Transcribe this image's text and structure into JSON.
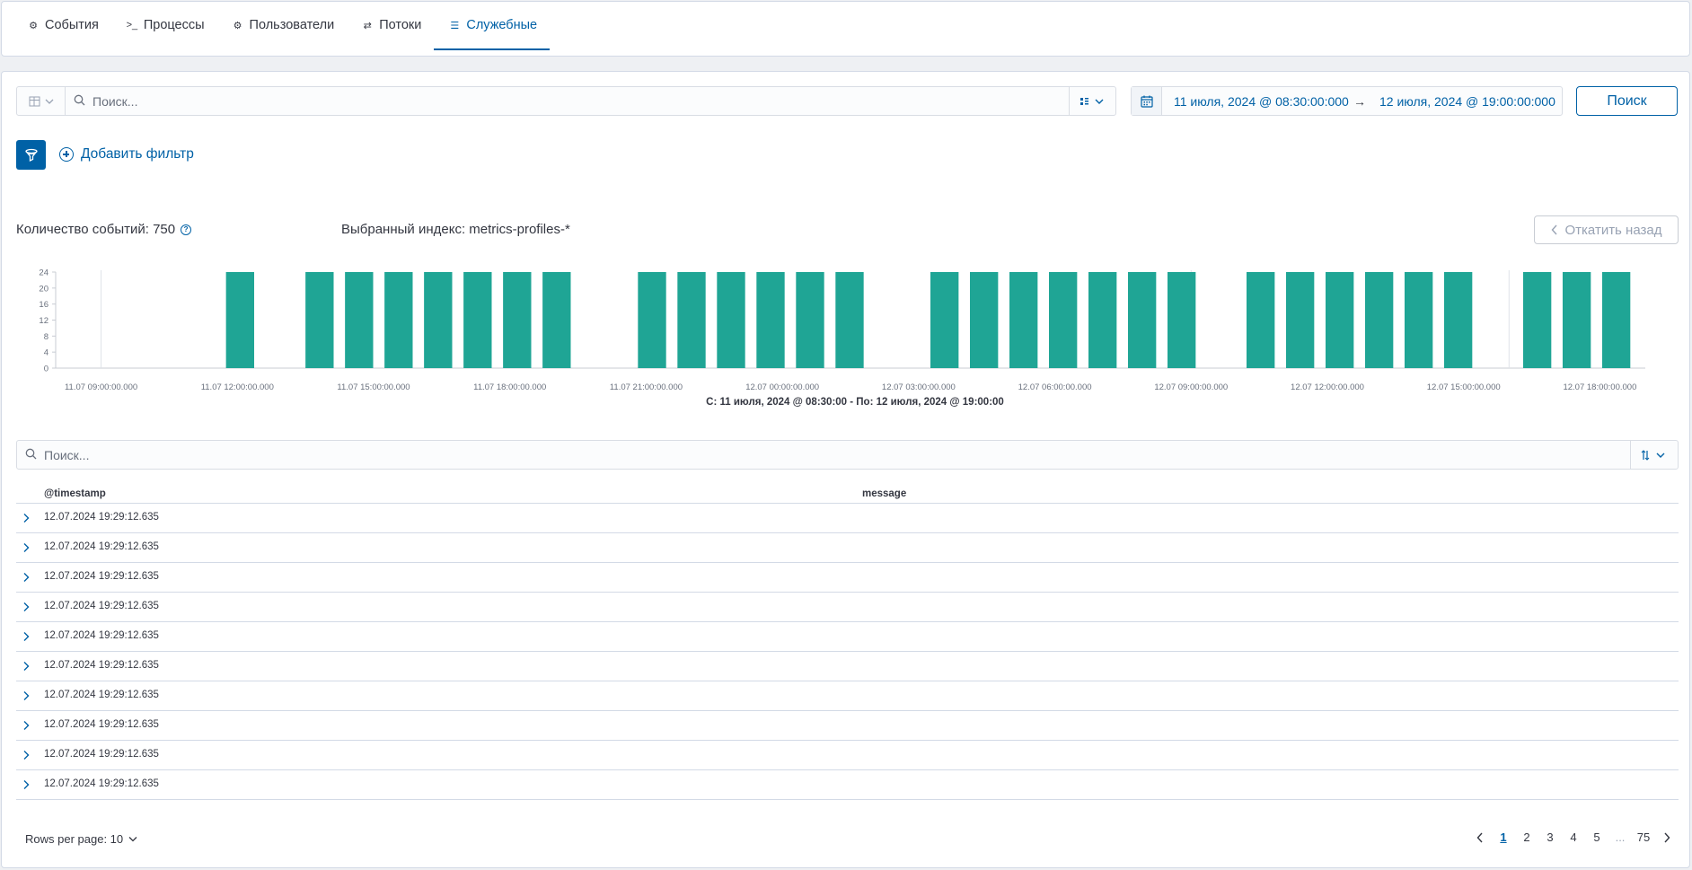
{
  "tabs": [
    {
      "label": "События",
      "icon": "events-icon"
    },
    {
      "label": "Процессы",
      "icon": "terminal-icon"
    },
    {
      "label": "Пользователи",
      "icon": "users-icon"
    },
    {
      "label": "Потоки",
      "icon": "flows-icon"
    },
    {
      "label": "Служебные",
      "icon": "layers-icon",
      "active": true
    }
  ],
  "query": {
    "placeholder": "Поиск..."
  },
  "date_range": {
    "start": "11 июля, 2024 @ 08:30:00:000",
    "arrow": "→",
    "end": "12 июля, 2024 @ 19:00:00:000"
  },
  "search_button": "Поиск",
  "add_filter": "Добавить фильтр",
  "event_count": "Количество событий: 750",
  "selected_index": "Выбранный индекс: metrics-profiles-*",
  "rollback_button": "Откатить назад",
  "chart_data": {
    "type": "bar",
    "y_ticks": [
      "24",
      "20",
      "16",
      "12",
      "8",
      "4",
      "0"
    ],
    "ylim": [
      0,
      24
    ],
    "x_ticks": [
      "11.07 09:00:00.000",
      "11.07 12:00:00.000",
      "11.07 15:00:00.000",
      "11.07 18:00:00.000",
      "11.07 21:00:00.000",
      "12.07 00:00:00.000",
      "12.07 03:00:00.000",
      "12.07 06:00:00.000",
      "12.07 09:00:00.000",
      "12.07 12:00:00.000",
      "12.07 15:00:00.000",
      "12.07 18:00:00.000"
    ],
    "x_range_hours": [
      8,
      43
    ],
    "bar_width_hours": 0.62,
    "bars": [
      {
        "x": "11.07 11:45",
        "h": 11.75,
        "v": 24
      },
      {
        "x": "11.07 13:30",
        "h": 13.5,
        "v": 24
      },
      {
        "x": "11.07 14:22",
        "h": 14.37,
        "v": 24
      },
      {
        "x": "11.07 15:15",
        "h": 15.24,
        "v": 24
      },
      {
        "x": "11.07 16:07",
        "h": 16.11,
        "v": 24
      },
      {
        "x": "11.07 17:00",
        "h": 16.98,
        "v": 24
      },
      {
        "x": "11.07 17:50",
        "h": 17.85,
        "v": 24
      },
      {
        "x": "11.07 18:43",
        "h": 18.72,
        "v": 24
      },
      {
        "x": "11.07 20:50",
        "h": 20.82,
        "v": 24
      },
      {
        "x": "11.07 21:42",
        "h": 21.69,
        "v": 24
      },
      {
        "x": "11.07 22:34",
        "h": 22.56,
        "v": 24
      },
      {
        "x": "11.07 23:25",
        "h": 23.43,
        "v": 24
      },
      {
        "x": "12.07 00:18",
        "h": 24.3,
        "v": 24
      },
      {
        "x": "12.07 01:10",
        "h": 25.17,
        "v": 24
      },
      {
        "x": "12.07 03:15",
        "h": 27.26,
        "v": 24
      },
      {
        "x": "12.07 04:08",
        "h": 28.13,
        "v": 24
      },
      {
        "x": "12.07 05:00",
        "h": 29.0,
        "v": 24
      },
      {
        "x": "12.07 05:52",
        "h": 29.87,
        "v": 24
      },
      {
        "x": "12.07 06:44",
        "h": 30.74,
        "v": 24
      },
      {
        "x": "12.07 07:36",
        "h": 31.61,
        "v": 24
      },
      {
        "x": "12.07 08:28",
        "h": 32.48,
        "v": 24
      },
      {
        "x": "12.07 10:12",
        "h": 34.22,
        "v": 24
      },
      {
        "x": "12.07 11:05",
        "h": 35.09,
        "v": 24
      },
      {
        "x": "12.07 11:57",
        "h": 35.96,
        "v": 24
      },
      {
        "x": "12.07 12:49",
        "h": 36.83,
        "v": 24
      },
      {
        "x": "12.07 13:42",
        "h": 37.7,
        "v": 24
      },
      {
        "x": "12.07 14:34",
        "h": 38.57,
        "v": 24
      },
      {
        "x": "12.07 16:19",
        "h": 40.31,
        "v": 24
      },
      {
        "x": "12.07 17:11",
        "h": 41.18,
        "v": 24
      },
      {
        "x": "12.07 18:03",
        "h": 42.05,
        "v": 24
      }
    ],
    "caption": "С: 11 июля, 2024 @ 08:30:00 - По: 12 июля, 2024 @ 19:00:00",
    "color": "#1fa595"
  },
  "table_search": {
    "placeholder": "Поиск..."
  },
  "table": {
    "columns": [
      "@timestamp",
      "message"
    ],
    "rows": [
      "12.07.2024 19:29:12.635",
      "12.07.2024 19:29:12.635",
      "12.07.2024 19:29:12.635",
      "12.07.2024 19:29:12.635",
      "12.07.2024 19:29:12.635",
      "12.07.2024 19:29:12.635",
      "12.07.2024 19:29:12.635",
      "12.07.2024 19:29:12.635",
      "12.07.2024 19:29:12.635",
      "12.07.2024 19:29:12.635"
    ]
  },
  "rows_per_page": "Rows per page: 10",
  "pagination": {
    "pages": [
      "1",
      "2",
      "3",
      "4",
      "5"
    ],
    "ellipsis": "...",
    "last": "75",
    "current": "1"
  }
}
